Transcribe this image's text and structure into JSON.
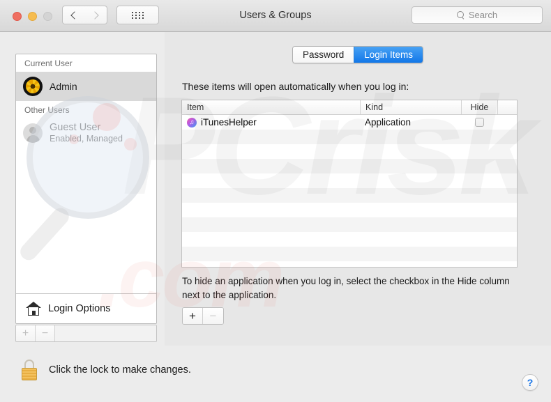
{
  "window": {
    "title": "Users & Groups",
    "traffic_lights": [
      "close",
      "minimize",
      "zoom"
    ],
    "nav": {
      "back_icon": "chevron-left-icon",
      "forward_icon": "chevron-right-icon",
      "grid_icon": "show-all-grid-icon"
    }
  },
  "search": {
    "placeholder": "Search",
    "value": "",
    "icon": "search-icon"
  },
  "sidebar": {
    "groups": [
      {
        "header": "Current User",
        "users": [
          {
            "name": "Admin",
            "sub": "",
            "avatar": "sunflower-avatar",
            "selected": true
          }
        ]
      },
      {
        "header": "Other Users",
        "users": [
          {
            "name": "Guest User",
            "sub": "Enabled, Managed",
            "avatar": "guest-silhouette-avatar",
            "selected": false
          }
        ]
      }
    ],
    "login_options": {
      "label": "Login Options",
      "icon": "house-icon"
    },
    "controls": {
      "add": "+",
      "remove": "−"
    }
  },
  "main": {
    "tabs": [
      {
        "label": "Password",
        "active": false
      },
      {
        "label": "Login Items",
        "active": true
      }
    ],
    "intro": "These items will open automatically when you log in:",
    "table": {
      "columns": [
        "Item",
        "Kind",
        "Hide"
      ],
      "rows": [
        {
          "item": "iTunesHelper",
          "kind": "Application",
          "hide_checked": false,
          "icon": "itunes-icon"
        }
      ],
      "empty_rows": 10
    },
    "hint": "To hide an application when you log in, select the checkbox in the Hide column next to the application.",
    "controls": {
      "add": "+",
      "remove": "−"
    }
  },
  "footer": {
    "lock_label": "Click the lock to make changes.",
    "lock_icon": "padlock-closed-icon",
    "lock_state": "locked",
    "help_label": "?"
  },
  "colors": {
    "accent": "#1277e8",
    "window_bg": "#ececec",
    "panel_bg": "#e7e7e7",
    "selection": "#d9d9d9",
    "lock_gold": "#f3c15e"
  }
}
